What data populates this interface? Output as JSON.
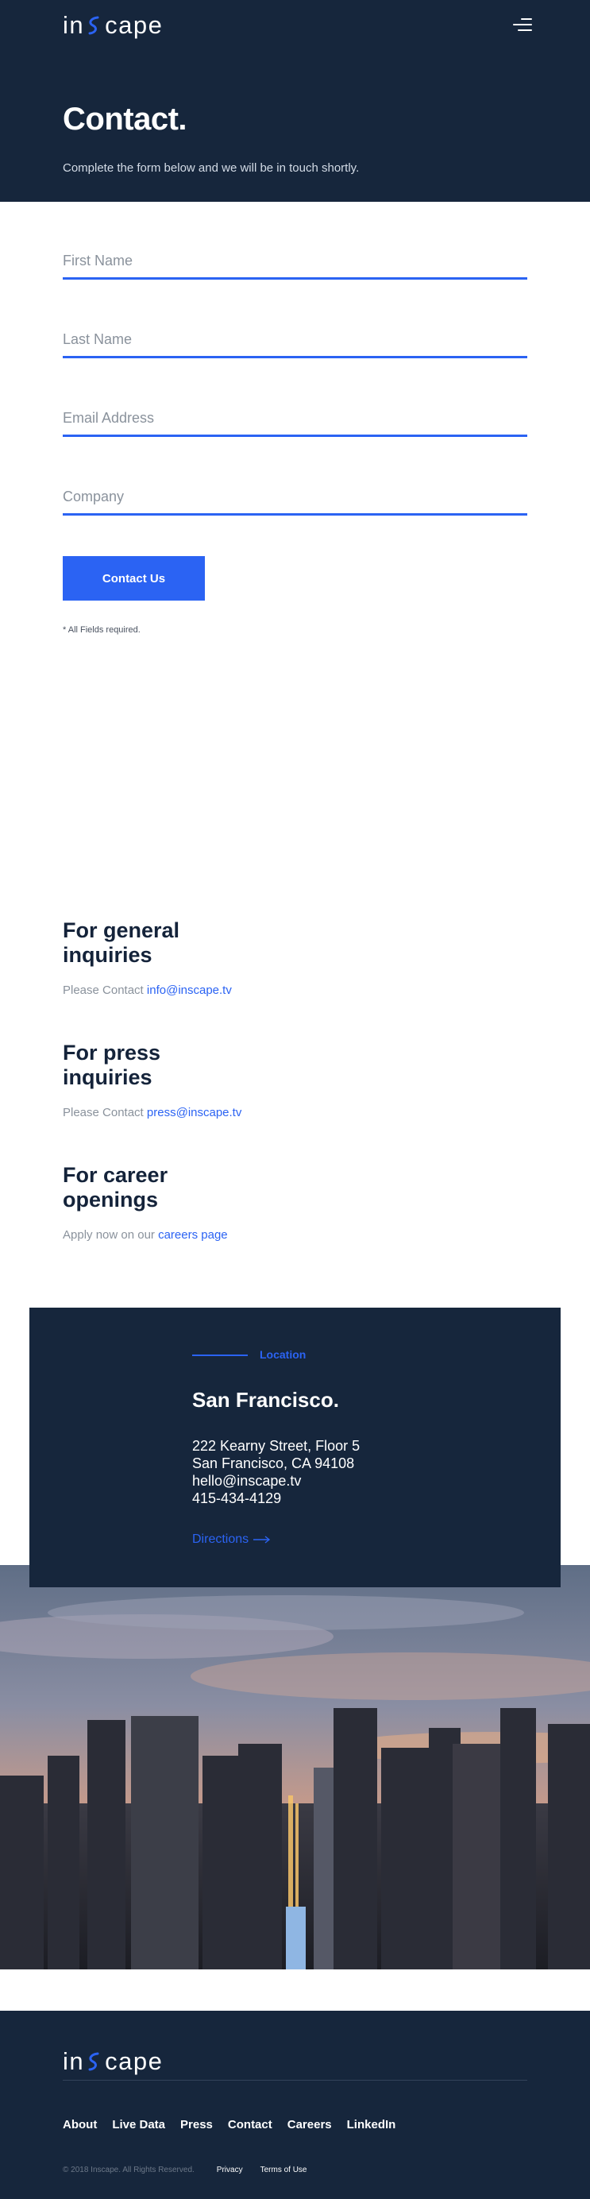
{
  "header": {
    "logo_text": "inscape",
    "logo_prefix": "in",
    "logo_suffix": "cape",
    "menu_icon": "hamburger-menu-icon"
  },
  "hero": {
    "title": "Contact.",
    "subtitle": "Complete the form below and we will be in touch shortly."
  },
  "form": {
    "first_name_placeholder": "First Name",
    "last_name_placeholder": "Last Name",
    "email_placeholder": "Email Address",
    "company_placeholder": "Company",
    "submit_label": "Contact Us",
    "required_note": "* All Fields required."
  },
  "inquiries": [
    {
      "title": "For general inquiries",
      "prefix": "Please Contact ",
      "link": "info@inscape.tv"
    },
    {
      "title": "For press inquiries",
      "prefix": "Please Contact ",
      "link": "press@inscape.tv"
    },
    {
      "title": "For career openings",
      "prefix": "Apply now on our ",
      "link": "careers page"
    }
  ],
  "location": {
    "label": "Location",
    "city": "San Francisco.",
    "address_line1": "222 Kearny Street, Floor 5",
    "address_line2": "San Francisco, CA 94108",
    "email": "hello@inscape.tv",
    "phone": "415-434-4129",
    "directions_label": "Directions",
    "directions_icon": "arrow-right-icon"
  },
  "footer": {
    "nav": [
      "About",
      "Live Data",
      "Press",
      "Contact",
      "Careers",
      "LinkedIn"
    ],
    "copyright": "© 2018 Inscape. All Rights Reserved.",
    "privacy": "Privacy",
    "terms": "Terms of Use"
  },
  "colors": {
    "navy": "#16263c",
    "accent_blue": "#2b63f3",
    "muted_text": "#8a929c"
  }
}
